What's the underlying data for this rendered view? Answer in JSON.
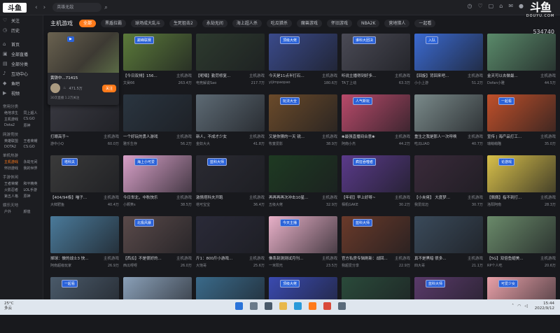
{
  "app": {
    "logo": "斗鱼",
    "search_placeholder": "英雄无敌",
    "brand_main": "斗鱼",
    "brand_sub": "DOUYU.COM",
    "viewer_count": "534740"
  },
  "sidebar": {
    "items": [
      {
        "icon": "heart-icon",
        "glyph": "♡",
        "label": "关注"
      },
      {
        "icon": "history-icon",
        "glyph": "◷",
        "label": "历史"
      }
    ],
    "items2": [
      {
        "icon": "home-icon",
        "glyph": "⌂",
        "label": "首页"
      },
      {
        "icon": "live-icon",
        "glyph": "▣",
        "label": "全部直播"
      },
      {
        "icon": "category-icon",
        "glyph": "▤",
        "label": "全部分类"
      },
      {
        "icon": "voice-icon",
        "glyph": "♪",
        "label": "互动中心"
      },
      {
        "icon": "fish-icon",
        "glyph": "◆",
        "label": "鱼吧"
      },
      {
        "icon": "video-icon",
        "glyph": "▶",
        "label": "视频"
      }
    ],
    "section1": "常用分类",
    "grid1": [
      "绝地求生",
      "同上超人",
      "主机游戏",
      "CS:GO",
      "Dota2",
      "原神"
    ],
    "section2": "网游竞技",
    "grid2": [
      "英雄联盟",
      "王者荣耀",
      "DOTA2",
      "CS:GO"
    ],
    "section3": "单机热游",
    "grid3": [
      "主机游戏",
      "永劫无间",
      "怀旧游戏",
      "我的世界"
    ],
    "section4": "手游休闲",
    "grid4": [
      "王者荣耀",
      "和平精英",
      "火影忍者",
      "LOL手游",
      "第五人格",
      "原神"
    ],
    "section5": "娱乐天地",
    "grid5": [
      "户外",
      "颜值"
    ]
  },
  "main": {
    "title": "主机游戏",
    "tabs": [
      "全部",
      "黑盾拉霸",
      "球场成大乱斗",
      "生死狙击2",
      "永劫无间",
      "海上超人杀",
      "吃瓜猎杀",
      "魔兽游戏",
      "怀旧游戏",
      "NBA2K",
      "营地猎人",
      "一起看"
    ]
  },
  "popup": {
    "title": "黄铁中...71415",
    "fans": "471.5万",
    "follow_label": "关注",
    "footer": "30次直播 1.2万关注"
  },
  "cards": [
    {
      "title": "黄铁中...71415",
      "cat": "主机游戏",
      "streamer": "老黄",
      "views": "471.5万",
      "bg": "#6a6250",
      "badge": ""
    },
    {
      "title": "【今日双排】156...",
      "cat": "主机游戏",
      "streamer": "文昊66",
      "views": "263.4万",
      "bg": "#5b7a3a",
      "badge": "巅峰联赛"
    },
    {
      "title": "【呢喃】勤劳修复...",
      "cat": "主机游戏",
      "streamer": "电竞解说Sao",
      "views": "217.7万",
      "bg": "#2d3a2e",
      "badge": ""
    },
    {
      "title": "今天是11点半打石...",
      "cat": "主机游戏",
      "streamer": "yijimpaopao",
      "views": "180.6万",
      "bg": "#3a4a8a",
      "badge": "顶级大佬"
    },
    {
      "title": "听说主播得到好多...",
      "cat": "主机游戏",
      "streamer": "TA丁上动",
      "views": "63.3万",
      "bg": "#4a4a55",
      "badge": "谁科大团决"
    },
    {
      "title": "【回旋】背回来吧...",
      "cat": "主机游戏",
      "streamer": "小小上游",
      "views": "51.2万",
      "bg": "#3b6ad1",
      "badge": "入队"
    },
    {
      "title": "金天可以去做最...",
      "cat": "主机游戏",
      "streamer": "Dofan小雅",
      "views": "44.5万",
      "bg": "#5a8a6a",
      "badge": ""
    },
    {
      "title": "打眼高手~",
      "cat": "主机游戏",
      "streamer": "游中小Q",
      "views": "60.0万",
      "bg": "#3a3a42",
      "badge": "顶级吞天"
    },
    {
      "title": "一个好玩的勇人游戏",
      "cat": "主机游戏",
      "streamer": "雅乐生存",
      "views": "56.2万",
      "bg": "#2a3540",
      "badge": ""
    },
    {
      "title": "新人，不成才少女",
      "cat": "主机游戏",
      "streamer": "金奴大大",
      "views": "41.8万",
      "bg": "#5d6a74",
      "badge": ""
    },
    {
      "title": "又是你猜的一天 锐...",
      "cat": "主机游戏",
      "streamer": "牧童爱影",
      "views": "38.9万",
      "bg": "#6a4a2a",
      "badge": "玩法大全"
    },
    {
      "title": "❀最强直播间合意❀",
      "cat": "主机游戏",
      "streamer": "阿南小杰",
      "views": "44.2万",
      "bg": "#b84a6a",
      "badge": "人气新玩"
    },
    {
      "title": "重生之我是那人一次呼唤",
      "cat": "主机游戏",
      "streamer": "吃瓜LIAO",
      "views": "40.7万",
      "bg": "#7a8a8a",
      "badge": ""
    },
    {
      "title": "宣传 | 海产品打工...",
      "cat": "主机游戏",
      "streamer": "瑞萌萌瞄",
      "views": "35.0万",
      "bg": "#c0502a",
      "badge": "一起看"
    },
    {
      "title": "【404/94极】喵子...",
      "cat": "主机游戏",
      "streamer": "大鲜肥鱼",
      "views": "40.4万",
      "bg": "#3a3a3a",
      "badge": "塔科夫"
    },
    {
      "title": "今日世北，中秋快乐",
      "cat": "主机游戏",
      "streamer": "小颗笑s",
      "views": "38.5万",
      "bg": "#d8a0c8",
      "badge": "海上小可爱"
    },
    {
      "title": "激情塔科夫开跑",
      "cat": "主机游戏",
      "streamer": "塔可宝宝",
      "views": "36.4万",
      "bg": "#2a2a32",
      "badge": "蓝科大师"
    },
    {
      "title": "再再再再次冲击10星...",
      "cat": "主机游戏",
      "streamer": "五级大佬",
      "views": "32.9万",
      "bg": "#1e3a22",
      "badge": ""
    },
    {
      "title": "【年初】早上好呀~",
      "cat": "主机游戏",
      "streamer": "相机GAKE",
      "views": "30.2万",
      "bg": "#5a3a8a",
      "badge": "疯狂吞噬者"
    },
    {
      "title": "【小夹佬】 大度梦...",
      "cat": "主机游戏",
      "streamer": "我爱炫迈",
      "views": "30.7万",
      "bg": "#3a2a3a",
      "badge": ""
    },
    {
      "title": "【佩佩】指不到打...",
      "cat": "主机游戏",
      "streamer": "洛阳阿南",
      "views": "28.3万",
      "bg": "#d8c04a",
      "badge": "论游戏"
    },
    {
      "title": "掉球：做的战士3 快...",
      "cat": "主机游戏",
      "streamer": "阿南超级玩家",
      "views": "26.9万",
      "bg": "#4a7a9a",
      "badge": ""
    },
    {
      "title": "【西瓜】不是很好的...",
      "cat": "主机游戏",
      "streamer": "西瓜呀呀",
      "views": "26.0万",
      "bg": "#5a4a4a",
      "badge": "北极风暴"
    },
    {
      "title": "斤1：800斤小游戏...",
      "cat": "主机游戏",
      "streamer": "大饱哥",
      "views": "25.6万",
      "bg": "#2a2a38",
      "badge": ""
    },
    {
      "title": "佛系刻测测试月刊...",
      "cat": "主机游戏",
      "streamer": "一米阳光",
      "views": "23.5万",
      "bg": "#e8b0c8",
      "badge": "今天主播"
    },
    {
      "title": "官方私房专辑刷新：战回...",
      "cat": "主机游戏",
      "streamer": "我超爱分享",
      "views": "22.9万",
      "bg": "#6a3a2a",
      "badge": "蓝科大师"
    },
    {
      "title": "真不是黑暗 很多...",
      "cat": "主机游戏",
      "streamer": "四大哥",
      "views": "21.1万",
      "bg": "#3a4a5a",
      "badge": ""
    },
    {
      "title": "【5G】双倍鱼翅美...",
      "cat": "主机游戏",
      "streamer": "RP个人吃",
      "views": "20.6万",
      "bg": "#6a8a6a",
      "badge": ""
    },
    {
      "title": "",
      "cat": "",
      "streamer": "",
      "views": "",
      "bg": "#4a5a6a",
      "badge": "一起看"
    },
    {
      "title": "",
      "cat": "",
      "streamer": "",
      "views": "",
      "bg": "#8aa0b8",
      "badge": ""
    },
    {
      "title": "",
      "cat": "",
      "streamer": "",
      "views": "",
      "bg": "#3a6a8a",
      "badge": ""
    },
    {
      "title": "",
      "cat": "",
      "streamer": "",
      "views": "",
      "bg": "#3a4ab0",
      "badge": "顶级大佬"
    },
    {
      "title": "",
      "cat": "",
      "streamer": "",
      "views": "",
      "bg": "#2a4a3a",
      "badge": ""
    },
    {
      "title": "",
      "cat": "",
      "streamer": "",
      "views": "",
      "bg": "#5a3a6a",
      "badge": "蓝科大师"
    },
    {
      "title": "",
      "cat": "",
      "streamer": "",
      "views": "",
      "bg": "#e8a0a8",
      "badge": "可爱少女"
    }
  ],
  "taskbar": {
    "weather_temp": "25°C",
    "weather_desc": "多云",
    "time": "15:44",
    "date": "2022/9/12",
    "apps": [
      {
        "icon": "windows-icon",
        "color": "#2a73d9"
      },
      {
        "icon": "search-icon",
        "color": "#6a7a8a"
      },
      {
        "icon": "taskview-icon",
        "color": "#4a5a6a"
      },
      {
        "icon": "explorer-icon",
        "color": "#e8b84a"
      },
      {
        "icon": "edge-icon",
        "color": "#2a9ad9"
      },
      {
        "icon": "douyu-icon",
        "color": "#ff7a1a"
      },
      {
        "icon": "chrome-icon",
        "color": "#d94a3a"
      },
      {
        "icon": "settings-icon",
        "color": "#5a6a7a"
      }
    ]
  }
}
